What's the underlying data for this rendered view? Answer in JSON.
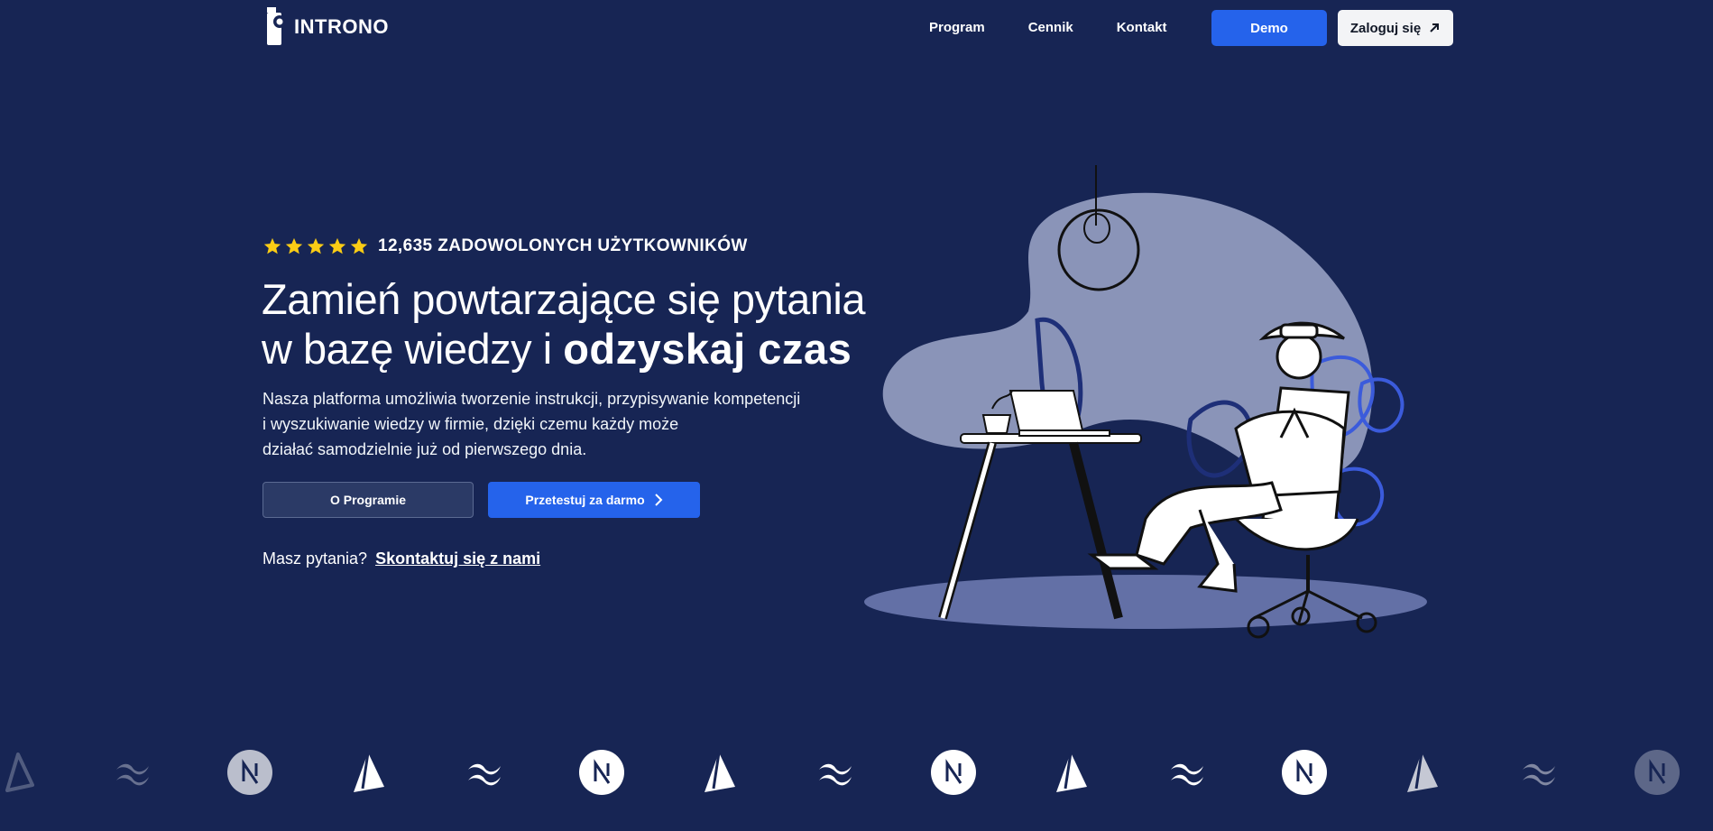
{
  "brand": {
    "name": "INTRONO"
  },
  "nav": {
    "links": [
      "Program",
      "Cennik",
      "Kontakt"
    ],
    "demo_label": "Demo",
    "login_label": "Zaloguj się"
  },
  "hero": {
    "rating_stars": 5,
    "rating_text": "12,635 ZADOWOLONYCH UŻYTKOWNIKÓW",
    "headline_line1": "Zamień powtarzające się pytania",
    "headline_line2_plain": "w bazę wiedzy i ",
    "headline_line2_bold": "odzyskaj czas",
    "description_line1": "Nasza platforma umożliwia tworzenie instrukcji, przypisywanie kompetencji",
    "description_line2": "i wyszukiwanie wiedzy w firmie, dzięki czemu każdy może",
    "description_line3": "działać samodzielnie już od pierwszego dnia.",
    "program_button": "O Programie",
    "try_button": "Przetestuj za darmo",
    "contact_prefix": "Masz pytania?",
    "contact_link": "Skontaktuj się z nami"
  },
  "logo_strip": [
    "prisma-logo",
    "tailwind-logo",
    "nextjs-logo",
    "prisma-logo",
    "tailwind-logo",
    "nextjs-logo",
    "prisma-logo",
    "tailwind-logo",
    "nextjs-logo",
    "prisma-logo",
    "tailwind-logo",
    "nextjs-logo",
    "prisma-logo",
    "tailwind-logo",
    "nextjs-logo"
  ],
  "colors": {
    "background": "#172554",
    "accent": "#2563eb",
    "star": "#facc15"
  }
}
